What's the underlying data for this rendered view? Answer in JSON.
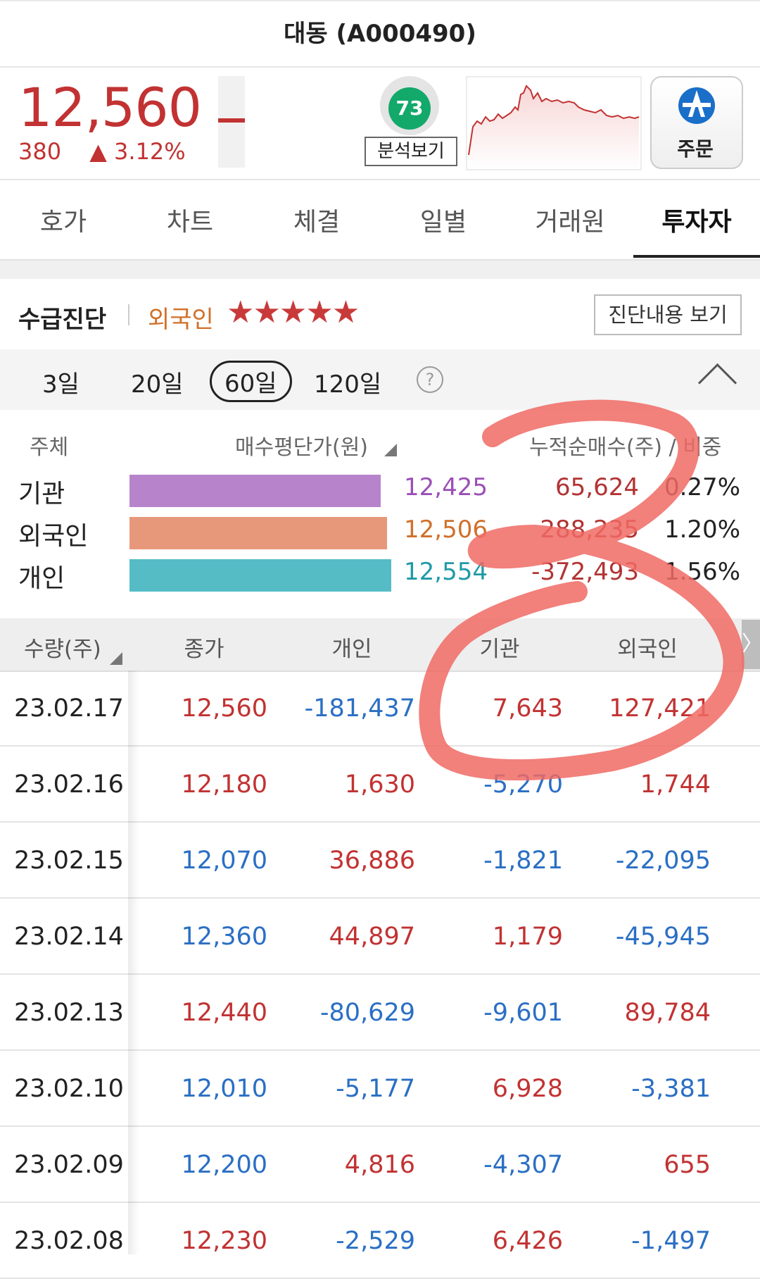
{
  "header": {
    "title": "대동 (A000490)"
  },
  "quote": {
    "price": "12,560",
    "change": "380",
    "change_pct": "▲ 3.12%",
    "score": "73",
    "analyze_label": "분석보기",
    "order_label": "주문"
  },
  "tabs": [
    {
      "label": "호가"
    },
    {
      "label": "차트"
    },
    {
      "label": "체결"
    },
    {
      "label": "일별"
    },
    {
      "label": "거래원"
    },
    {
      "label": "투자자"
    }
  ],
  "diagnosis": {
    "title": "수급진단",
    "subject": "외국인",
    "stars": "★★★★★",
    "rating": 5,
    "button": "진단내용 보기"
  },
  "periods": [
    {
      "label": "3일"
    },
    {
      "label": "20일"
    },
    {
      "label": "60일"
    },
    {
      "label": "120일"
    }
  ],
  "periods_help": "?",
  "summary": {
    "col_subject": "주체",
    "col_avg_price": "매수평단가(원)",
    "col_cum": "누적순매수(주) / 비중",
    "rows": [
      {
        "label": "기관",
        "avg_price": "12,425",
        "cum": "65,624",
        "pct": "0.27%",
        "bar_fraction": 0.96,
        "color": "#b784cc"
      },
      {
        "label": "외국인",
        "avg_price": "12,506",
        "cum": "288,235",
        "pct": "1.20%",
        "bar_fraction": 0.985,
        "color": "#e8987a"
      },
      {
        "label": "개인",
        "avg_price": "12,554",
        "cum": "-372,493",
        "pct": "1.56%",
        "bar_fraction": 1.0,
        "color": "#55bcc6"
      }
    ]
  },
  "table": {
    "headers": [
      "수량(주)",
      "종가",
      "개인",
      "기관",
      "외국인"
    ],
    "scroll_glyph": "〉",
    "rows": [
      {
        "date": "23.02.17",
        "close": "12,560",
        "indiv": "-181,437",
        "inst": "7,643",
        "foreign": "127,421"
      },
      {
        "date": "23.02.16",
        "close": "12,180",
        "indiv": "1,630",
        "inst": "-5,270",
        "foreign": "1,744"
      },
      {
        "date": "23.02.15",
        "close": "12,070",
        "indiv": "36,886",
        "inst": "-1,821",
        "foreign": "-22,095"
      },
      {
        "date": "23.02.14",
        "close": "12,360",
        "indiv": "44,897",
        "inst": "1,179",
        "foreign": "-45,945"
      },
      {
        "date": "23.02.13",
        "close": "12,440",
        "indiv": "-80,629",
        "inst": "-9,601",
        "foreign": "89,784"
      },
      {
        "date": "23.02.10",
        "close": "12,010",
        "indiv": "-5,177",
        "inst": "6,928",
        "foreign": "-3,381"
      },
      {
        "date": "23.02.09",
        "close": "12,200",
        "indiv": "4,816",
        "inst": "-4,307",
        "foreign": "655"
      },
      {
        "date": "23.02.08",
        "close": "12,230",
        "indiv": "-2,529",
        "inst": "6,426",
        "foreign": "-1,497"
      }
    ]
  },
  "colors": {
    "up": "#c23232",
    "down": "#2a6fc4",
    "annotation": "#f06a64"
  }
}
